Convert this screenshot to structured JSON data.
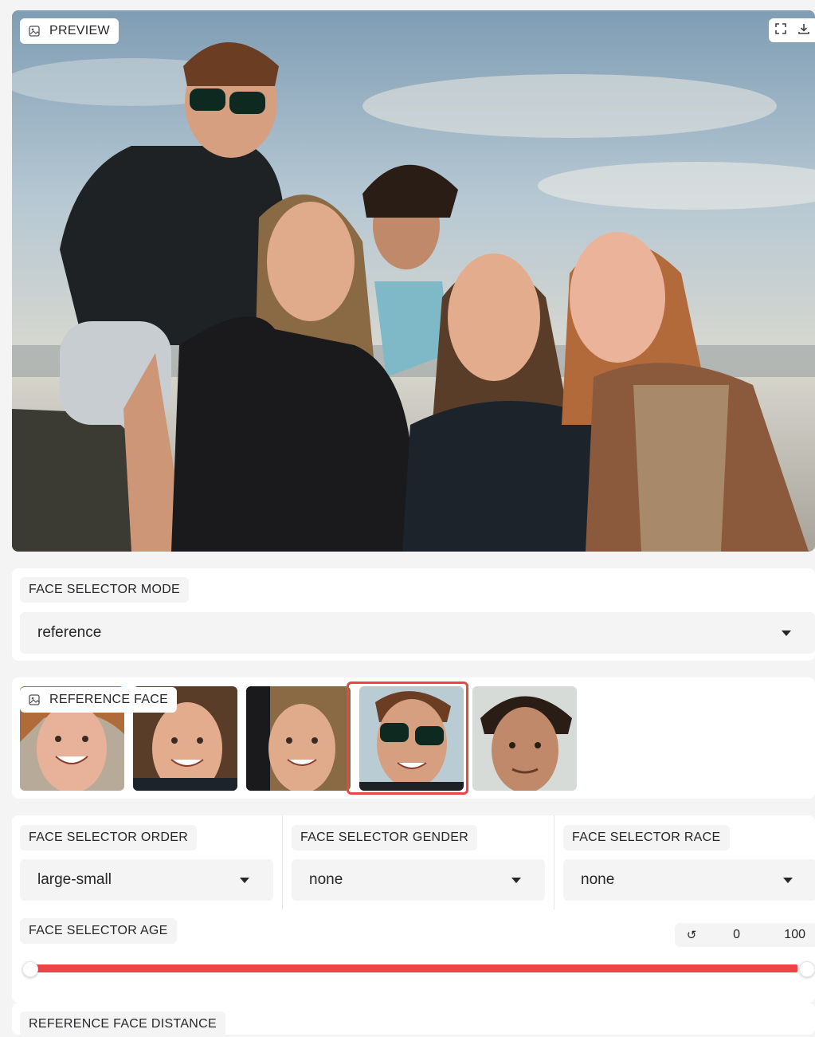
{
  "preview": {
    "label": "PREVIEW",
    "icons": [
      "image-icon",
      "fullscreen-icon",
      "download-icon"
    ]
  },
  "face_selector_mode": {
    "label": "FACE SELECTOR MODE",
    "value": "reference"
  },
  "reference_face": {
    "label": "REFERENCE FACE",
    "thumbnails": [
      {
        "name": "red-haired woman smiling"
      },
      {
        "name": "brunette woman smiling"
      },
      {
        "name": "long-haired woman smiling"
      },
      {
        "name": "man with sunglasses",
        "selected": true
      },
      {
        "name": "curly-haired young man"
      }
    ],
    "selected_color": "#ef4444"
  },
  "face_selector_order": {
    "label": "FACE SELECTOR ORDER",
    "value": "large-small"
  },
  "face_selector_gender": {
    "label": "FACE SELECTOR GENDER",
    "value": "none"
  },
  "face_selector_race": {
    "label": "FACE SELECTOR RACE",
    "value": "none"
  },
  "face_selector_age": {
    "label": "FACE SELECTOR AGE",
    "reset_icon": "↺",
    "min_value": "0",
    "max_value": "100",
    "range": [
      0,
      100
    ],
    "accent": "#ef4444"
  },
  "reference_face_distance": {
    "label": "REFERENCE FACE DISTANCE"
  }
}
